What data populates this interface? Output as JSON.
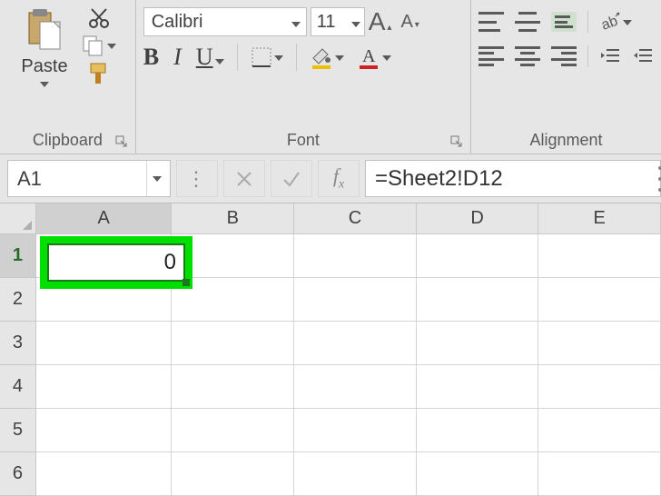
{
  "ribbon": {
    "clipboard": {
      "label": "Clipboard",
      "paste": "Paste"
    },
    "font": {
      "label": "Font",
      "name": "Calibri",
      "size": "11",
      "bold": "B",
      "italic": "I",
      "underline": "U"
    },
    "alignment": {
      "label": "Alignment"
    }
  },
  "formula_bar": {
    "name_box": "A1",
    "formula": "=Sheet2!D12"
  },
  "grid": {
    "columns": [
      "A",
      "B",
      "C",
      "D",
      "E"
    ],
    "rows": [
      "1",
      "2",
      "3",
      "4",
      "5",
      "6"
    ],
    "selected_cell": "A1",
    "selected_value": "0"
  },
  "colors": {
    "highlight": "#00e000",
    "ribbon_bg": "#e6e6e6",
    "font_color_underline": "#d02020",
    "fill_color_underline": "#f0c000"
  }
}
